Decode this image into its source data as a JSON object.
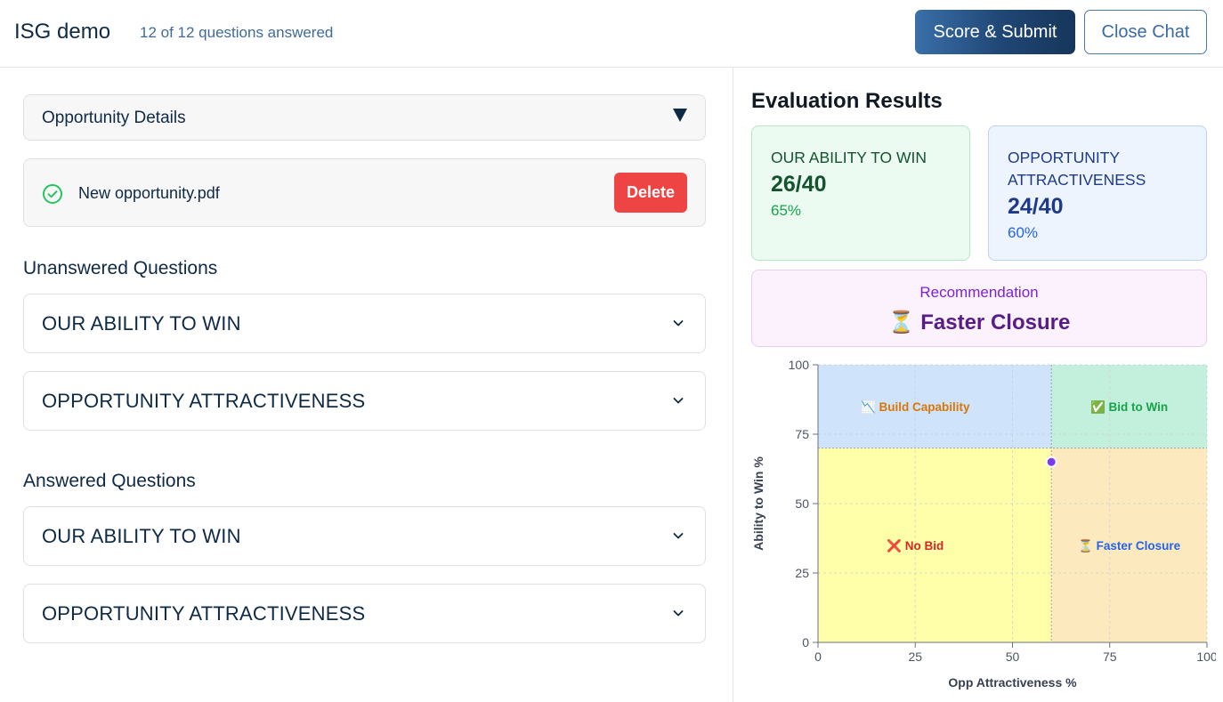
{
  "header": {
    "title": "ISG demo",
    "progress": "12 of 12 questions answered",
    "submit_label": "Score & Submit",
    "close_label": "Close Chat"
  },
  "opportunity": {
    "details_label": "Opportunity Details",
    "file_name": "New opportunity.pdf",
    "delete_label": "Delete"
  },
  "unanswered": {
    "title": "Unanswered Questions",
    "items": [
      {
        "label": "OUR ABILITY TO WIN"
      },
      {
        "label": "OPPORTUNITY ATTRACTIVENESS"
      }
    ]
  },
  "answered": {
    "title": "Answered Questions",
    "items": [
      {
        "label": "OUR ABILITY TO WIN"
      },
      {
        "label": "OPPORTUNITY ATTRACTIVENESS"
      }
    ]
  },
  "results": {
    "title": "Evaluation Results",
    "ability": {
      "title": "OUR ABILITY TO WIN",
      "score": "26/40",
      "pct": "65%"
    },
    "attractiveness": {
      "title": "OPPORTUNITY ATTRACTIVENESS",
      "score": "24/40",
      "pct": "60%"
    },
    "recommendation": {
      "label": "Recommendation",
      "value": "⏳ Faster Closure"
    }
  },
  "colors": {
    "accent": "#1f4674",
    "delete": "#ef4444",
    "green": "#16a34a",
    "blue": "#2563eb",
    "purple": "#581c87"
  },
  "chart_data": {
    "type": "scatter",
    "xlabel": "Opp Attractiveness %",
    "ylabel": "Ability to Win %",
    "xlim": [
      0,
      100
    ],
    "ylim": [
      0,
      100
    ],
    "xticks": [
      0,
      25,
      50,
      75,
      100
    ],
    "yticks": [
      0,
      25,
      50,
      75,
      100
    ],
    "grid": true,
    "thresholds": {
      "x": 60,
      "y": 70
    },
    "quadrants": [
      {
        "key": "build",
        "label": "Build Capability",
        "icon": "📉",
        "x0": 0,
        "x1": 60,
        "y0": 70,
        "y1": 100,
        "fill": "#cfe3fb",
        "text_color": "#d97706",
        "label_x": 25,
        "label_y": 85
      },
      {
        "key": "bid",
        "label": "Bid to Win",
        "icon": "✅",
        "x0": 60,
        "x1": 100,
        "y0": 70,
        "y1": 100,
        "fill": "#c3f0dc",
        "text_color": "#16a34a",
        "label_x": 80,
        "label_y": 85
      },
      {
        "key": "nobid",
        "label": "No Bid",
        "icon": "❌",
        "x0": 0,
        "x1": 60,
        "y0": 0,
        "y1": 70,
        "fill": "#feffa8",
        "text_color": "#dc2626",
        "label_x": 25,
        "label_y": 35
      },
      {
        "key": "faster",
        "label": "Faster Closure",
        "icon": "⏳",
        "x0": 60,
        "x1": 100,
        "y0": 0,
        "y1": 70,
        "fill": "#fde9be",
        "text_color": "#2563eb",
        "label_x": 80,
        "label_y": 35
      }
    ],
    "points": [
      {
        "x": 60,
        "y": 65,
        "color": "#7c3aed"
      }
    ]
  }
}
